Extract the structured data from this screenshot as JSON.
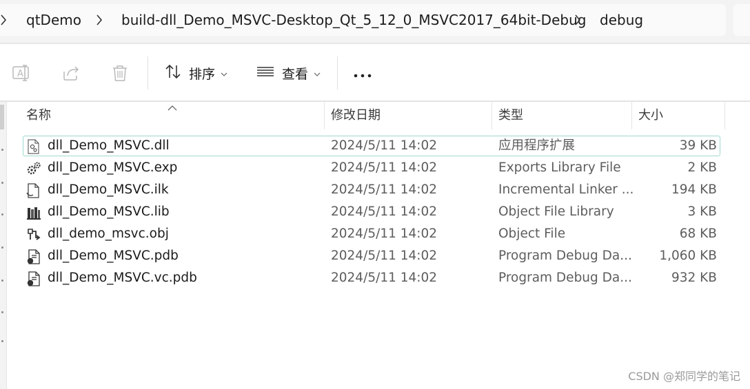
{
  "breadcrumb": {
    "items": [
      "qtDemo",
      "build-dll_Demo_MSVC-Desktop_Qt_5_12_0_MSVC2017_64bit-Debug",
      "debug"
    ]
  },
  "toolbar": {
    "sort_label": "排序",
    "view_label": "查看",
    "icons": [
      "rename-icon",
      "share-icon",
      "delete-icon",
      "sort-icon",
      "view-icon",
      "more-icon"
    ]
  },
  "columns": {
    "name": "名称",
    "date": "修改日期",
    "type": "类型",
    "size": "大小"
  },
  "files": [
    {
      "name": "dll_Demo_MSVC.dll",
      "date": "2024/5/11 14:02",
      "type": "应用程序扩展",
      "size": "39 KB",
      "icon": "dll-file-icon",
      "selected": true
    },
    {
      "name": "dll_Demo_MSVC.exp",
      "date": "2024/5/11 14:02",
      "type": "Exports Library File",
      "size": "2 KB",
      "icon": "exp-file-icon"
    },
    {
      "name": "dll_Demo_MSVC.ilk",
      "date": "2024/5/11 14:02",
      "type": "Incremental Linker ...",
      "size": "194 KB",
      "icon": "ilk-file-icon"
    },
    {
      "name": "dll_Demo_MSVC.lib",
      "date": "2024/5/11 14:02",
      "type": "Object File Library",
      "size": "3 KB",
      "icon": "lib-file-icon"
    },
    {
      "name": "dll_demo_msvc.obj",
      "date": "2024/5/11 14:02",
      "type": "Object File",
      "size": "68 KB",
      "icon": "obj-file-icon"
    },
    {
      "name": "dll_Demo_MSVC.pdb",
      "date": "2024/5/11 14:02",
      "type": "Program Debug Da...",
      "size": "1,060 KB",
      "icon": "pdb-file-icon"
    },
    {
      "name": "dll_Demo_MSVC.vc.pdb",
      "date": "2024/5/11 14:02",
      "type": "Program Debug Da...",
      "size": "932 KB",
      "icon": "pdb-file-icon"
    }
  ],
  "watermark": "CSDN @郑同学的笔记"
}
